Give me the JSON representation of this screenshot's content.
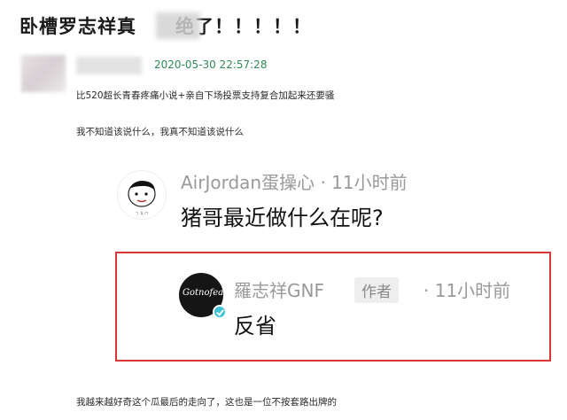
{
  "post": {
    "title": "卧槽罗志祥真　　绝了！！！！！",
    "timestamp": "2020-05-30 22:57:28",
    "paragraphs": [
      "比520超长青春疼痛小说+亲自下场投票支持复合加起来还要骚",
      "我不知道该说什么，我真不知道该说什么",
      "我越来越好奇这个瓜最后的走向了，这也是一位不按套路出牌的"
    ]
  },
  "screenshot": {
    "comment": {
      "username": "AirJordan蛋操心 · 11小时前",
      "text": "猪哥最近做什么在呢?"
    },
    "reply": {
      "username": "羅志祥GNF",
      "badge": "作者",
      "time": "· 11小时前",
      "text": "反省",
      "avatar_text": "Gotnofears"
    }
  },
  "colors": {
    "timestamp": "#2e8b57",
    "highlight_border": "#d93737",
    "verify_badge": "#3cc3d6"
  }
}
